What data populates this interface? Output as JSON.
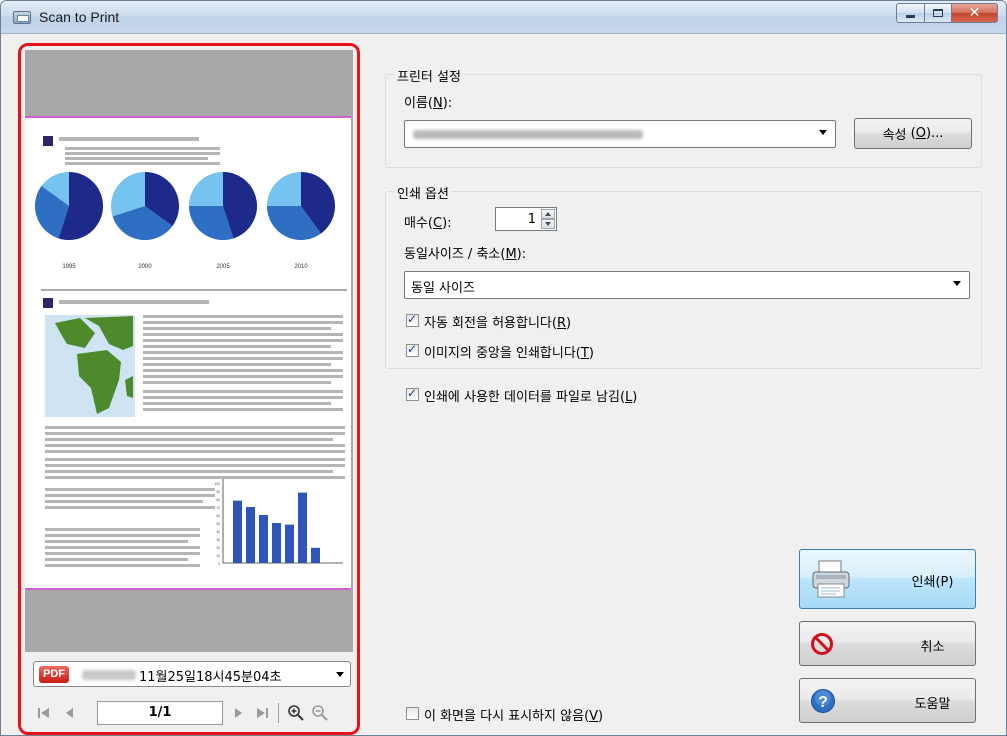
{
  "window": {
    "title": "Scan to Print",
    "controls": [
      "minimize",
      "maximize",
      "close"
    ]
  },
  "preview": {
    "file_select": {
      "badge": "PDF",
      "value": "11월25일18시45분04초"
    },
    "page_indicator": "1/1",
    "thumbnail": {
      "pie_years": [
        "1995",
        "2000",
        "2005",
        "2010"
      ],
      "bar_axis_ticks": [
        "100",
        "90",
        "80",
        "70",
        "60",
        "50",
        "40",
        "30",
        "20",
        "10",
        "0"
      ],
      "bar_values": [
        78,
        70,
        60,
        50,
        48,
        88,
        19
      ]
    }
  },
  "printer_settings": {
    "group_title": "프린터 설정",
    "name_label": "이름",
    "name_mnemonic": "N",
    "properties_button": "속성",
    "properties_mnemonic": "O"
  },
  "print_options": {
    "group_title": "인쇄 옵션",
    "copies_label": "매수",
    "copies_mnemonic": "C",
    "copies_value": "1",
    "size_label": "동일사이즈 / 축소",
    "size_mnemonic": "M",
    "size_value": "동일 사이즈",
    "auto_rotate_label": "자동 회전을 허용합니다",
    "auto_rotate_mnemonic": "R",
    "auto_rotate_checked": true,
    "center_label": "이미지의 중앙을 인쇄합니다",
    "center_mnemonic": "T",
    "center_checked": true
  },
  "keep_file": {
    "label": "인쇄에 사용한 데이터를 파일로 남김",
    "mnemonic": "L",
    "checked": true
  },
  "dont_show": {
    "label": "이 화면을 다시 표시하지 않음",
    "mnemonic": "V",
    "checked": false
  },
  "buttons": {
    "print": "인쇄(P)",
    "cancel": "취소",
    "help": "도움말"
  },
  "colors": {
    "highlight_border": "#e8121a",
    "pie_dark": "#1e2a8a",
    "pie_mid": "#2f6fc3",
    "pie_light": "#77c3f0",
    "bar_color": "#2f55b8",
    "map_green": "#4d8a2c"
  }
}
